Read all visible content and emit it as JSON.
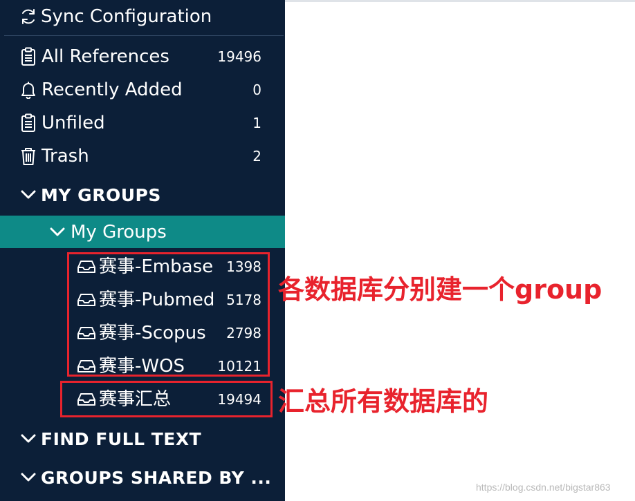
{
  "sidebar": {
    "sync_label": "Sync Configuration",
    "library_items": [
      {
        "label": "All References",
        "count": "19496",
        "icon": "clipboard-icon"
      },
      {
        "label": "Recently Added",
        "count": "0",
        "icon": "bell-icon"
      },
      {
        "label": "Unfiled",
        "count": "1",
        "icon": "clipboard-icon"
      },
      {
        "label": "Trash",
        "count": "2",
        "icon": "trash-icon"
      }
    ],
    "my_groups_header": "MY GROUPS",
    "group_set_label": "My Groups",
    "groups": [
      {
        "label": "赛事-Embase",
        "count": "1398",
        "icon": "group-tray-icon"
      },
      {
        "label": "赛事-Pubmed",
        "count": "5178",
        "icon": "group-tray-icon"
      },
      {
        "label": "赛事-Scopus",
        "count": "2798",
        "icon": "group-tray-icon"
      },
      {
        "label": "赛事-WOS",
        "count": "10121",
        "icon": "group-tray-icon"
      },
      {
        "label": "赛事汇总",
        "count": "19494",
        "icon": "group-tray-icon"
      }
    ],
    "find_full_text_header": "FIND FULL TEXT",
    "groups_shared_header": "GROUPS SHARED BY ..."
  },
  "annotations": {
    "per_database_note": "各数据库分别建一个group",
    "summary_note": "汇总所有数据库的",
    "color": "#e8232d"
  },
  "watermark": "https://blog.csdn.net/bigstar863",
  "colors": {
    "sidebar_bg": "#0c1f38",
    "selected_bg": "#0e8a87"
  }
}
